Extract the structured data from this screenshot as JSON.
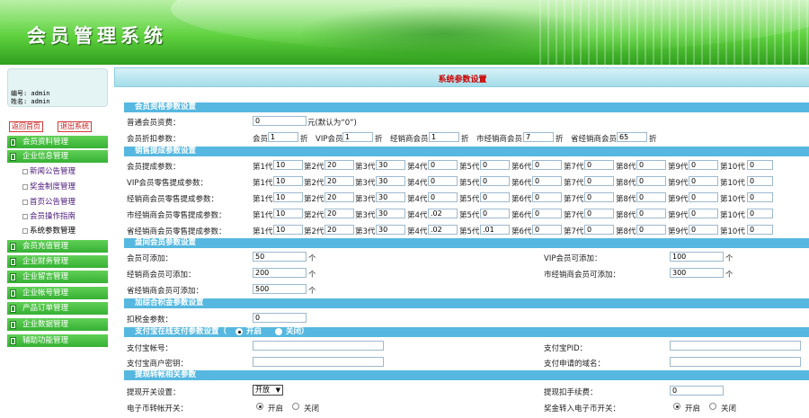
{
  "header": {
    "app_title": "会员管理系统"
  },
  "user": {
    "id_line": "编号: admin",
    "name_line": "姓名: admin"
  },
  "sidebar": {
    "home_button": "返回首页",
    "logout_button": "退出系统",
    "menu": [
      "会员资料管理",
      "企业信息管理",
      "会员充值管理",
      "企业财务管理",
      "企业留言管理",
      "企业帐号管理",
      "产品订单管理",
      "企业数据管理",
      "辅助功能管理"
    ],
    "submenu": [
      "新闻公告管理",
      "奖金制度管理",
      "首页公告管理",
      "会员操作指南",
      "系统参数管理"
    ]
  },
  "page": {
    "title": "系统参数设置"
  },
  "sections": {
    "member_fee": "会员资格参数设置",
    "sales_reward": "销售提成参数设置",
    "outlet": "盘间会员参数设置",
    "consume_fund": "加综合积金参数设置",
    "alipay_prefix": "支付宝在线支付参数设置（",
    "alipay_on": "开启",
    "alipay_off": "关闭）",
    "transfer": "提现转帐相关参数"
  },
  "member_fee": {
    "label": "普通会员资费：",
    "value": "0",
    "suffix": "元(默认为“0”)",
    "discount_label": "会员折扣参数：",
    "discount": [
      {
        "label": "会员",
        "value": "1",
        "unit": "折"
      },
      {
        "label": "VIP会员",
        "value": "1",
        "unit": "折"
      },
      {
        "label": "经销商会员",
        "value": "1",
        "unit": "折"
      },
      {
        "label": "市经销商会员",
        "value": "7",
        "unit": "折"
      },
      {
        "label": "省经销商会员",
        "value": "65",
        "unit": "折"
      }
    ]
  },
  "sales": {
    "rows": [
      {
        "label": "会员提成参数：",
        "values": [
          "10",
          "20",
          "30",
          "0",
          "0",
          "0",
          "0",
          "0",
          "0",
          "0"
        ]
      },
      {
        "label": "VIP会员零售提成参数：",
        "values": [
          "10",
          "20",
          "30",
          "0",
          "0",
          "0",
          "0",
          "0",
          "0",
          "0"
        ]
      },
      {
        "label": "经销商会员零售提成参数：",
        "values": [
          "10",
          "20",
          "30",
          "0",
          "0",
          "0",
          "0",
          "0",
          "0",
          "0"
        ]
      },
      {
        "label": "市经销商会员零售提成参数：",
        "values": [
          "10",
          "20",
          "30",
          ".02",
          "0",
          "0",
          "0",
          "0",
          "0",
          "0"
        ]
      },
      {
        "label": "省经销商会员零售提成参数：",
        "values": [
          "10",
          "20",
          "30",
          ".02",
          ".01",
          "0",
          "0",
          "0",
          "0",
          "0"
        ]
      }
    ],
    "gen_labels": [
      "第1代",
      "第2代",
      "第3代",
      "第4代",
      "第5代",
      "第6代",
      "第7代",
      "第8代",
      "第9代",
      "第10代"
    ]
  },
  "outlet": {
    "member_label": "会员可添加：",
    "member_value": "50",
    "vip_label": "VIP会员可添加：",
    "vip_value": "100",
    "dealer_label": "经销商会员可添加：",
    "dealer_value": "200",
    "city_label": "市经销商会员可添加：",
    "city_value": "300",
    "prov_label": "省经销商会员可添加：",
    "prov_value": "500",
    "unit": "个"
  },
  "consume": {
    "label": "扣税金参数：",
    "value": "0"
  },
  "alipay": {
    "account_label": "支付宝帐号：",
    "pid_label": "支付宝PID：",
    "key_label": "支付宝商户密钥：",
    "domain_label": "支付申请的域名："
  },
  "transfer": {
    "switch_label": "提现开关设置：",
    "switch_value": "开放",
    "fee_label": "提现扣手续费：",
    "fee_value": "0",
    "ecoin_label": "电子币转帐开关：",
    "ecoin_on": "开启",
    "ecoin_off": "关闭",
    "bonus_label": "奖金转入电子币开关：",
    "bonus_on": "开启",
    "bonus_off": "关闭"
  },
  "colors": {
    "accent_green": "#36b134",
    "section_blue": "#56b8e0",
    "title_red": "#cc0000"
  }
}
